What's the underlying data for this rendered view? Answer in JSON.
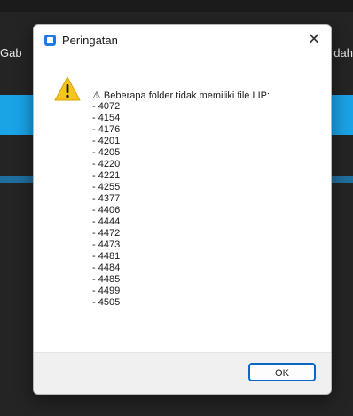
{
  "background": {
    "left_text": "Gab",
    "right_text": "dah"
  },
  "dialog": {
    "title": "Peringatan",
    "close_glyph": "✕",
    "message_prefix": "⚠",
    "message": " Beberapa folder tidak memiliki file LIP:",
    "items": [
      "- 4072",
      "- 4154",
      "- 4176",
      "- 4201",
      "- 4205",
      "- 4220",
      "- 4221",
      "- 4255",
      "- 4377",
      "- 4406",
      "- 4444",
      "- 4472",
      "- 4473",
      "- 4481",
      "- 4484",
      "- 4485",
      "- 4499",
      "- 4505"
    ],
    "ok_label": "OK"
  },
  "icons": {
    "app": "app-window-icon",
    "warning": "warning-triangle-icon",
    "close": "close-icon"
  },
  "colors": {
    "accent": "#0a67c4",
    "band": "#1aa3e6",
    "warning": "#f6c61e"
  }
}
